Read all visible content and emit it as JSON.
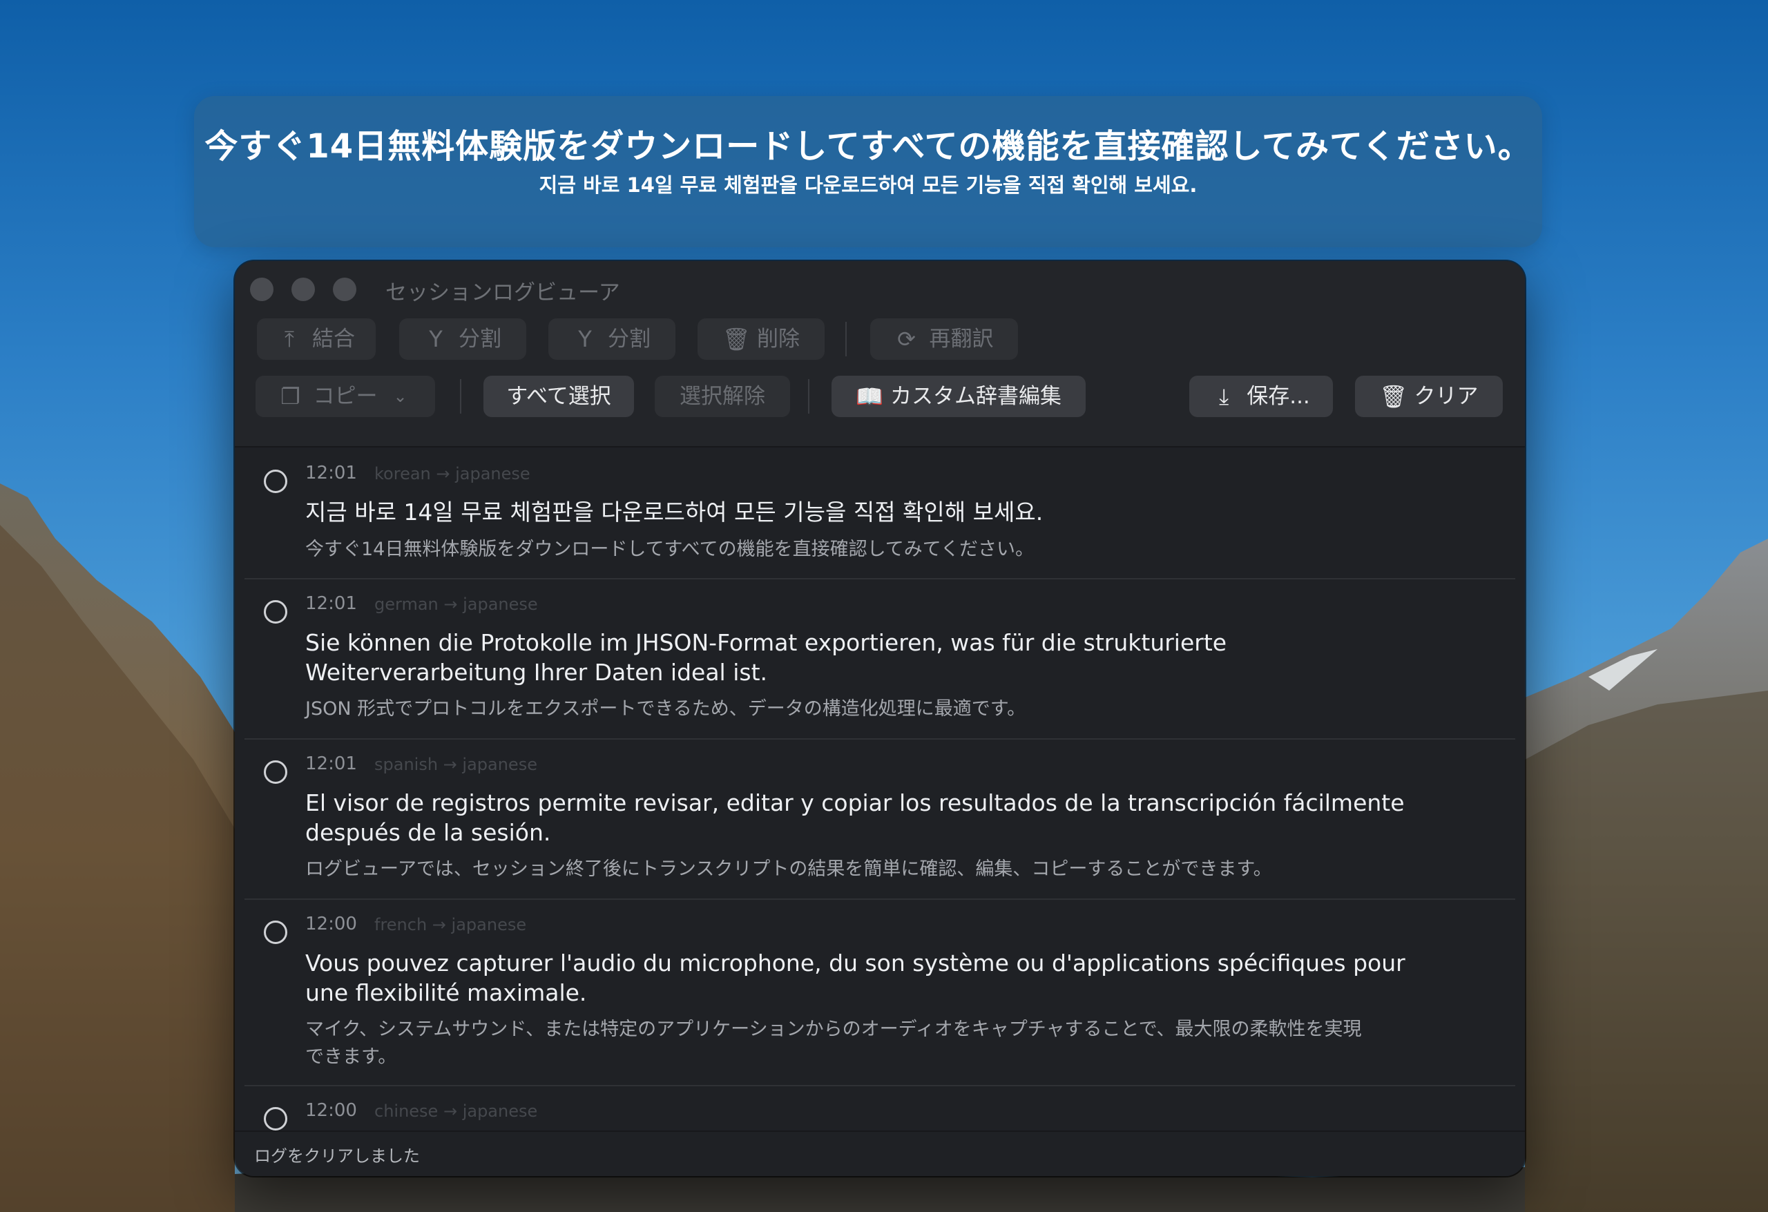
{
  "banner": {
    "line_ja": "今すぐ14日無料体験版をダウンロードしてすべての機能を直接確認してみてください。",
    "line_ko": "지금 바로 14일 무료 체험판을 다운로드하여 모든 기능을 직접 확인해 보세요."
  },
  "window": {
    "title": "セッションログビューア",
    "toolbar": {
      "merge": "結合",
      "split1": "分割",
      "split2": "分割",
      "delete": "削除",
      "retranslate": "再翻訳",
      "copy": "コピー",
      "select_all": "すべて選択",
      "deselect": "選択解除",
      "dict_edit": "カスタム辞書編集",
      "save": "保存...",
      "clear": "クリア"
    },
    "entries": [
      {
        "time": "12:01",
        "lang": "korean → japanese",
        "source": "지금 바로 14일 무료 체험판을 다운로드하여 모든 기능을 직접 확인해 보세요.",
        "translation": "今すぐ14日無料体験版をダウンロードしてすべての機能を直接確認してみてください。"
      },
      {
        "time": "12:01",
        "lang": "german → japanese",
        "source": "Sie können die Protokolle im JHSON-Format exportieren, was für die strukturierte Weiterverarbeitung Ihrer Daten ideal ist.",
        "translation": "JSON 形式でプロトコルをエクスポートできるため、データの構造化処理に最適です。"
      },
      {
        "time": "12:01",
        "lang": "spanish → japanese",
        "source": "El visor de registros permite revisar, editar y copiar los resultados de la transcripción fácilmente después de la sesión.",
        "translation": "ログビューアでは、セッション終了後にトランスクリプトの結果を簡単に確認、編集、コピーすることができます。"
      },
      {
        "time": "12:00",
        "lang": "french → japanese",
        "source": "Vous pouvez capturer l'audio du microphone, du son système ou d'applications spécifiques pour une flexibilité maximale.",
        "translation": "マイク、システムサウンド、または特定のアプリケーションからのオーディオをキャプチャすることで、最大限の柔軟性を実現できます。"
      },
      {
        "time": "12:00",
        "lang": "chinese → japanese",
        "source": "",
        "translation": ""
      }
    ],
    "status": "ログをクリアしました"
  },
  "icons": {
    "merge": "merge-icon",
    "split": "split-icon",
    "delete": "trash-icon",
    "retranslate": "refresh-icon",
    "copy": "copy-icon",
    "dict": "book-icon",
    "save": "download-icon",
    "clear": "trash-icon"
  }
}
